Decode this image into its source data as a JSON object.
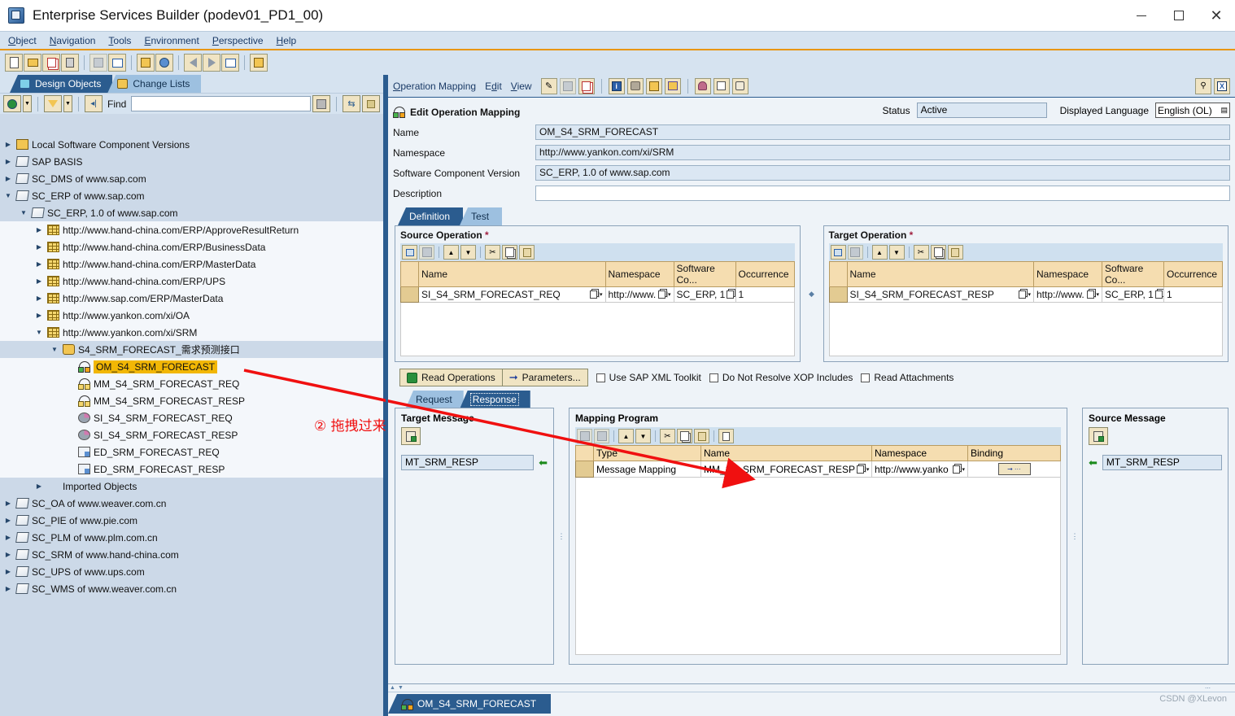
{
  "window": {
    "title": "Enterprise Services Builder (podev01_PD1_00)",
    "icon": "app-icon",
    "minimize": "–",
    "maximize": "□",
    "close": "✕"
  },
  "menubar": {
    "items": [
      {
        "label": "Object"
      },
      {
        "label": "Navigation"
      },
      {
        "label": "Tools"
      },
      {
        "label": "Environment"
      },
      {
        "label": "Perspective"
      },
      {
        "label": "Help"
      }
    ]
  },
  "toolbar": {
    "buttons": [
      {
        "name": "new-icon"
      },
      {
        "name": "open-icon"
      },
      {
        "name": "copy-icon"
      },
      {
        "name": "delete-icon"
      },
      {
        "name": "save-all-icon"
      },
      {
        "name": "activate-icon"
      },
      {
        "name": "where-used-icon"
      },
      {
        "name": "help-object-icon"
      },
      {
        "name": "back-icon"
      },
      {
        "name": "forward-icon"
      },
      {
        "name": "list-icon"
      },
      {
        "name": "user-roles-icon"
      }
    ]
  },
  "left": {
    "tabs": [
      {
        "label": "Design Objects",
        "active": true,
        "icon": "design-objects-icon"
      },
      {
        "label": "Change Lists",
        "active": false,
        "icon": "change-lists-icon"
      }
    ],
    "find": {
      "label": "Find",
      "value": "",
      "placeholder": ""
    },
    "tree": [
      {
        "label": "Local Software Component Versions",
        "indent": 0,
        "arrow": "right",
        "icon": "local-scv-icon",
        "bg": "blue"
      },
      {
        "label": "SAP BASIS",
        "indent": 0,
        "arrow": "right",
        "icon": "scv-icon",
        "bg": "blue"
      },
      {
        "label": "SC_DMS of www.sap.com",
        "indent": 0,
        "arrow": "right",
        "icon": "scv-icon",
        "bg": "blue"
      },
      {
        "label": "SC_ERP of www.sap.com",
        "indent": 0,
        "arrow": "down",
        "icon": "scv-icon",
        "bg": "blue"
      },
      {
        "label": "SC_ERP, 1.0 of www.sap.com",
        "indent": 1,
        "arrow": "down",
        "icon": "scv-version-icon",
        "bg": "blue"
      },
      {
        "label": "http://www.hand-china.com/ERP/ApproveResultReturn",
        "indent": 2,
        "arrow": "right",
        "icon": "namespace-icon",
        "bg": "white"
      },
      {
        "label": "http://www.hand-china.com/ERP/BusinessData",
        "indent": 2,
        "arrow": "right",
        "icon": "namespace-icon",
        "bg": "white"
      },
      {
        "label": "http://www.hand-china.com/ERP/MasterData",
        "indent": 2,
        "arrow": "right",
        "icon": "namespace-icon",
        "bg": "white"
      },
      {
        "label": "http://www.hand-china.com/ERP/UPS",
        "indent": 2,
        "arrow": "right",
        "icon": "namespace-icon",
        "bg": "white"
      },
      {
        "label": "http://www.sap.com/ERP/MasterData",
        "indent": 2,
        "arrow": "right",
        "icon": "namespace-icon",
        "bg": "white"
      },
      {
        "label": "http://www.yankon.com/xi/OA",
        "indent": 2,
        "arrow": "right",
        "icon": "namespace-icon",
        "bg": "white"
      },
      {
        "label": "http://www.yankon.com/xi/SRM",
        "indent": 2,
        "arrow": "down",
        "icon": "namespace-icon",
        "bg": "white"
      },
      {
        "label": "S4_SRM_FORECAST_需求预测接口",
        "indent": 3,
        "arrow": "down",
        "icon": "folder-icon",
        "bg": "blue"
      },
      {
        "label": "OM_S4_SRM_FORECAST",
        "indent": 4,
        "arrow": "none",
        "icon": "operation-mapping-icon",
        "bg": "white",
        "selected": true
      },
      {
        "label": "MM_S4_SRM_FORECAST_REQ",
        "indent": 4,
        "arrow": "none",
        "icon": "message-mapping-icon",
        "bg": "white"
      },
      {
        "label": "MM_S4_SRM_FORECAST_RESP",
        "indent": 4,
        "arrow": "none",
        "icon": "message-mapping-icon",
        "bg": "white"
      },
      {
        "label": "SI_S4_SRM_FORECAST_REQ",
        "indent": 4,
        "arrow": "none",
        "icon": "service-interface-icon",
        "bg": "white"
      },
      {
        "label": "SI_S4_SRM_FORECAST_RESP",
        "indent": 4,
        "arrow": "none",
        "icon": "service-interface-icon",
        "bg": "white"
      },
      {
        "label": "ED_SRM_FORECAST_REQ",
        "indent": 4,
        "arrow": "none",
        "icon": "external-definition-icon",
        "bg": "white"
      },
      {
        "label": "ED_SRM_FORECAST_RESP",
        "indent": 4,
        "arrow": "none",
        "icon": "external-definition-icon",
        "bg": "white"
      },
      {
        "label": "Imported Objects",
        "indent": 2,
        "arrow": "right",
        "icon": "none",
        "bg": "blue"
      },
      {
        "label": "SC_OA of www.weaver.com.cn",
        "indent": 0,
        "arrow": "right",
        "icon": "scv-icon",
        "bg": "blue"
      },
      {
        "label": "SC_PIE of www.pie.com",
        "indent": 0,
        "arrow": "right",
        "icon": "scv-icon",
        "bg": "blue"
      },
      {
        "label": "SC_PLM of www.plm.com.cn",
        "indent": 0,
        "arrow": "right",
        "icon": "scv-icon",
        "bg": "blue"
      },
      {
        "label": "SC_SRM of www.hand-china.com",
        "indent": 0,
        "arrow": "right",
        "icon": "scv-icon",
        "bg": "blue"
      },
      {
        "label": "SC_UPS of www.ups.com",
        "indent": 0,
        "arrow": "right",
        "icon": "scv-icon",
        "bg": "blue"
      },
      {
        "label": "SC_WMS of www.weaver.com.cn",
        "indent": 0,
        "arrow": "right",
        "icon": "scv-icon",
        "bg": "blue"
      }
    ]
  },
  "editor": {
    "menus": [
      {
        "label": "Operation Mapping"
      },
      {
        "label": "Edit"
      },
      {
        "label": "View"
      }
    ],
    "header": {
      "title": "Edit Operation Mapping",
      "status_label": "Status",
      "status_value": "Active",
      "language_label": "Displayed Language",
      "language_value": "English (OL)"
    },
    "fields": [
      {
        "label": "Name",
        "value": "OM_S4_SRM_FORECAST"
      },
      {
        "label": "Namespace",
        "value": "http://www.yankon.com/xi/SRM"
      },
      {
        "label": "Software Component Version",
        "value": "SC_ERP, 1.0 of www.sap.com"
      },
      {
        "label": "Description",
        "value": ""
      }
    ],
    "tabs": [
      {
        "label": "Definition",
        "active": true
      },
      {
        "label": "Test",
        "active": false
      }
    ],
    "source_operation": {
      "title": "Source Operation",
      "required_mark": "*",
      "columns": [
        "",
        "Name",
        "Namespace",
        "Software Co...",
        "Occurrence"
      ],
      "rows": [
        {
          "name": "SI_S4_SRM_FORECAST_REQ",
          "namespace": "http://www.",
          "swc": "SC_ERP, 1",
          "occurrence": "1"
        }
      ]
    },
    "target_operation": {
      "title": "Target Operation",
      "required_mark": "*",
      "columns": [
        "",
        "Name",
        "Namespace",
        "Software Co...",
        "Occurrence"
      ],
      "rows": [
        {
          "name": "SI_S4_SRM_FORECAST_RESP",
          "namespace": "http://www.",
          "swc": "SC_ERP, 1",
          "occurrence": "1"
        }
      ]
    },
    "actions": {
      "read_operations": "Read Operations",
      "parameters": "Parameters...",
      "checkboxes": [
        {
          "label": "Use SAP XML Toolkit",
          "checked": false
        },
        {
          "label": "Do Not Resolve XOP Includes",
          "checked": false
        },
        {
          "label": "Read Attachments",
          "checked": false
        }
      ]
    },
    "message_tabs": [
      {
        "label": "Request",
        "active": false
      },
      {
        "label": "Response",
        "active": true
      }
    ],
    "target_message": {
      "title": "Target Message",
      "value": "MT_SRM_RESP",
      "arrow": "left-arrow-icon"
    },
    "source_message": {
      "title": "Source Message",
      "value": "MT_SRM_RESP",
      "arrow": "left-arrow-icon"
    },
    "mapping_program": {
      "title": "Mapping Program",
      "columns": [
        "",
        "Type",
        "Name",
        "Namespace",
        "Binding"
      ],
      "rows": [
        {
          "type": "Message Mapping",
          "name": "MM_S4_SRM_FORECAST_RESP",
          "namespace": "http://www.yanko",
          "binding": "binding-button"
        }
      ]
    }
  },
  "footer": {
    "object_tab": "OM_S4_SRM_FORECAST",
    "watermark": "CSDN @XLevon"
  },
  "annotation": {
    "text": "② 拖拽过来",
    "color": "#f01010"
  },
  "colors": {
    "accent": "#2b5c8f",
    "panel": "#d6e3f0",
    "tree_bg": "#ccd9e8",
    "header_bg": "#f5ddb0",
    "selected": "#f2b705",
    "annotation": "#f01010",
    "orange_rule": "#e8960f"
  }
}
